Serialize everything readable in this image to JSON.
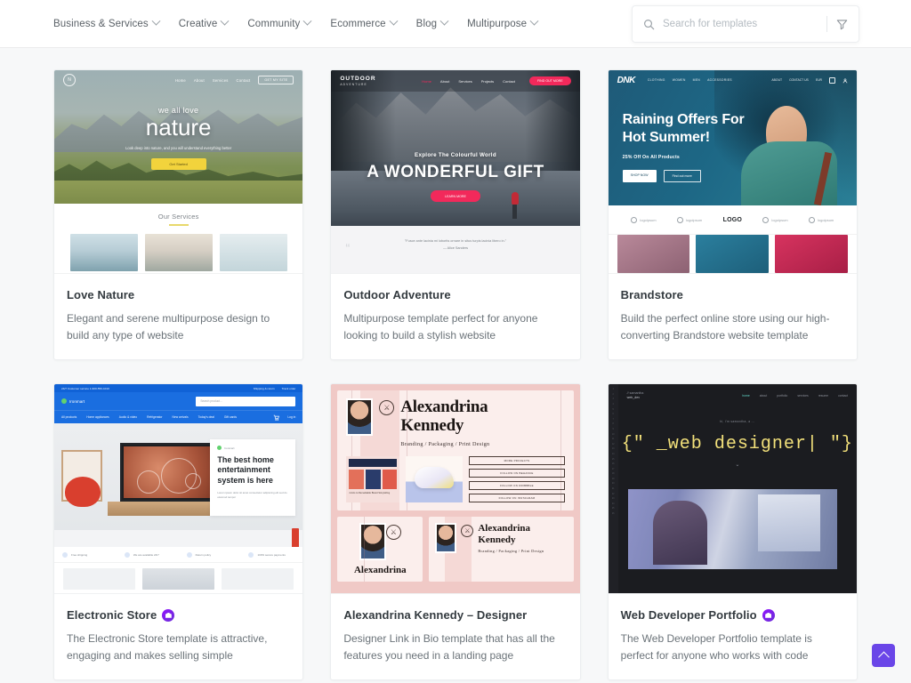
{
  "header": {
    "nav_items": [
      {
        "label": "Business & Services",
        "icon": "chevron-down-icon"
      },
      {
        "label": "Creative",
        "icon": "chevron-down-icon"
      },
      {
        "label": "Community",
        "icon": "chevron-down-icon"
      },
      {
        "label": "Ecommerce",
        "icon": "chevron-down-icon"
      },
      {
        "label": "Blog",
        "icon": "chevron-down-icon"
      },
      {
        "label": "Multipurpose",
        "icon": "chevron-down-icon"
      }
    ],
    "search": {
      "placeholder": "Search for templates",
      "value": "",
      "search_icon": "search-icon",
      "filter_icon": "filter-funnel-icon"
    }
  },
  "accent_color": "#6a46e8",
  "pro_badge_color": "#9013fe",
  "cards": [
    {
      "title": "Love Nature",
      "description": "Elegant and serene multipurpose design to build any type of website",
      "pro": false,
      "preview": {
        "logo": "N",
        "nav": [
          "Home",
          "About",
          "Services",
          "Contact"
        ],
        "nav_button": "GET MY SITE",
        "kicker": "we all love",
        "heading": "nature",
        "subtext": "Look deep into nature, and you will understand everything better",
        "cta": "Get Started",
        "section_title": "Our Services"
      }
    },
    {
      "title": "Outdoor Adventure",
      "description": "Multipurpose template perfect for anyone looking to build a stylish website",
      "pro": false,
      "preview": {
        "logo": "OUTDOOR",
        "logo_sub": "ADVENTURE",
        "nav": [
          "Home",
          "About",
          "Services",
          "Projects",
          "Contact"
        ],
        "nav_button": "FIND OUT MORE",
        "kicker": "Explore The Colourful World",
        "heading": "A WONDERFUL GIFT",
        "cta": "LEARN MORE",
        "quote": "\"Fusce ante lacinia mi lobortis ornare in situs turpis lacinia libero in.\"",
        "quote_author": "— Alice Sanders"
      }
    },
    {
      "title": "Brandstore",
      "description": "Build the perfect online store using our high-converting Brandstore website template",
      "pro": false,
      "preview": {
        "logo": "DNK",
        "nav": [
          "CLOTHING",
          "WOMEN",
          "MEN",
          "ACCESSORIES"
        ],
        "nav_right": [
          "ABOUT",
          "CONTACT US",
          "EUR"
        ],
        "heading_line1": "Raining Offers For",
        "heading_line2": "Hot Summer!",
        "subtext": "25% Off On All Products",
        "button_primary": "SHOP NOW",
        "button_secondary": "Find out more",
        "logo_strip": [
          "logoipsum",
          "logoipsum",
          "LOGO",
          "logoipsum",
          "logoipsum"
        ]
      }
    },
    {
      "title": "Electronic Store",
      "description": "The Electronic Store template is attractive, engaging and makes selling simple",
      "pro": true,
      "preview": {
        "topbar_left": "24/7 Customer service 1-900-550-1010",
        "topbar_right": [
          "Shipping & return",
          "Track order"
        ],
        "brand": "Ironmart",
        "search_placeholder": "Search product...",
        "nav": [
          "All products",
          "Home appliances",
          "Audio & video",
          "Refrigerator",
          "New arrivals",
          "Today's deal",
          "Gift cards"
        ],
        "nav_right": [
          "Log in"
        ],
        "card_heading": "The best home entertainment system is here",
        "card_text": "Lorem ipsum dolor sit amet consectetur adipiscing elit sed do eiusmod tempor",
        "features": [
          "Free shipping",
          "We are available 24/7",
          "Return policy",
          "100% secure payments"
        ]
      }
    },
    {
      "title": "Alexandrina Kennedy – Designer",
      "description": "Designer Link in Bio template that has all the features you need in a landing page",
      "pro": false,
      "preview": {
        "name_line1": "Alexandrina",
        "name_line2": "Kennedy",
        "tagline": "Branding / Packaging / Print Design",
        "project_caption": "4 Acts to Remarkable Brand Storytelling",
        "buttons": [
          "MORE PROJECTS",
          "FOLLOW ON BEHANCE",
          "FOLLOW ON DRIBBBLE",
          "FOLLOW ON INSTAGRAM"
        ]
      }
    },
    {
      "title": "Web Developer Portfolio",
      "description": "The Web Developer Portfolio template is perfect for anyone who works with code",
      "pro": true,
      "preview": {
        "logo": "// samantha",
        "logo_sub": "web_dev",
        "nav": [
          "home",
          "about",
          "portfolio",
          "services",
          "resume",
          "contact"
        ],
        "kicker": "hi, i'm samantha, a ...",
        "code": "{\" _web designer| \"}",
        "caret": "⌄"
      }
    }
  ],
  "scroll_to_top": {
    "label": "Scroll to top",
    "icon": "chevron-up-icon"
  }
}
